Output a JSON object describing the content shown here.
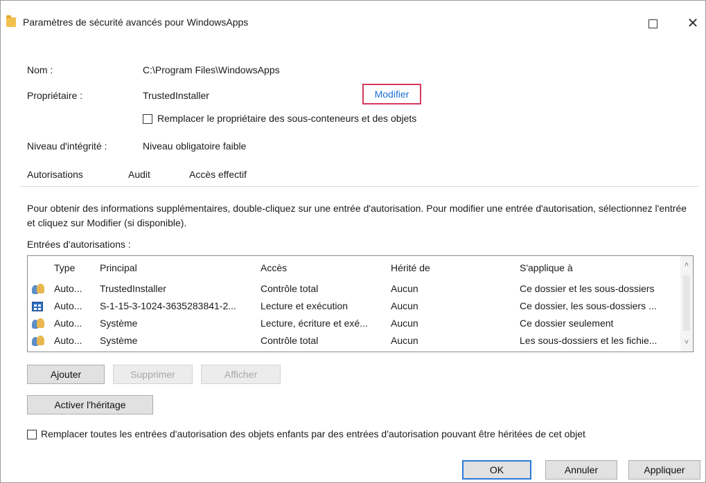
{
  "window": {
    "title": "Paramètres de sécurité avancés pour WindowsApps",
    "maximize_glyph": "",
    "close_glyph": "✕"
  },
  "object": {
    "name_label": "Nom :",
    "name_value": "C:\\Program Files\\WindowsApps",
    "owner_label": "Propriétaire :",
    "owner_value": "TrustedInstaller",
    "owner_modify_link": "Modifier",
    "replace_owner_label": "Remplacer le propriétaire des sous-conteneurs et des objets",
    "replace_owner_checked": false,
    "integrity_label": "Niveau d'intégrité :",
    "integrity_value": "Niveau obligatoire faible"
  },
  "tabs": [
    {
      "label": "Autorisations",
      "active": true
    },
    {
      "label": "Audit",
      "active": false
    },
    {
      "label": "Accès effectif",
      "active": false
    }
  ],
  "permissions": {
    "info_text": "Pour obtenir des informations supplémentaires, double-cliquez sur une entrée d'autorisation. Pour modifier une entrée d'autorisation, sélectionnez l'entrée et cliquez sur Modifier (si disponible).",
    "entries_label": "Entrées d'autorisations :",
    "columns": {
      "type": "Type",
      "principal": "Principal",
      "acces": "Accès",
      "herite": "Hérité de",
      "applique": "S'applique à"
    },
    "rows": [
      {
        "icon": "users-icon",
        "type": "Auto...",
        "principal": "TrustedInstaller",
        "acces": "Contrôle total",
        "herite": "Aucun",
        "applique": "Ce dossier et les sous-dossiers"
      },
      {
        "icon": "app-package-icon",
        "type": "Auto...",
        "principal": "S-1-15-3-1024-3635283841-2...",
        "acces": "Lecture et exécution",
        "herite": "Aucun",
        "applique": "Ce dossier, les sous-dossiers ..."
      },
      {
        "icon": "users-icon",
        "type": "Auto...",
        "principal": "Système",
        "acces": "Lecture, écriture et exé...",
        "herite": "Aucun",
        "applique": "Ce dossier seulement"
      },
      {
        "icon": "users-icon",
        "type": "Auto...",
        "principal": "Système",
        "acces": "Contrôle total",
        "herite": "Aucun",
        "applique": "Les sous-dossiers et les fichie..."
      }
    ],
    "scroll_up_glyph": "˄",
    "scroll_down_glyph": "˅"
  },
  "buttons": {
    "add": "Ajouter",
    "remove": "Supprimer",
    "view": "Afficher",
    "enable_inheritance": "Activer l'héritage"
  },
  "replace_children": {
    "label": "Remplacer toutes les entrées d'autorisation des objets enfants par des entrées d'autorisation pouvant être héritées de cet objet",
    "checked": false
  },
  "footer": {
    "ok": "OK",
    "cancel": "Annuler",
    "apply": "Appliquer"
  }
}
